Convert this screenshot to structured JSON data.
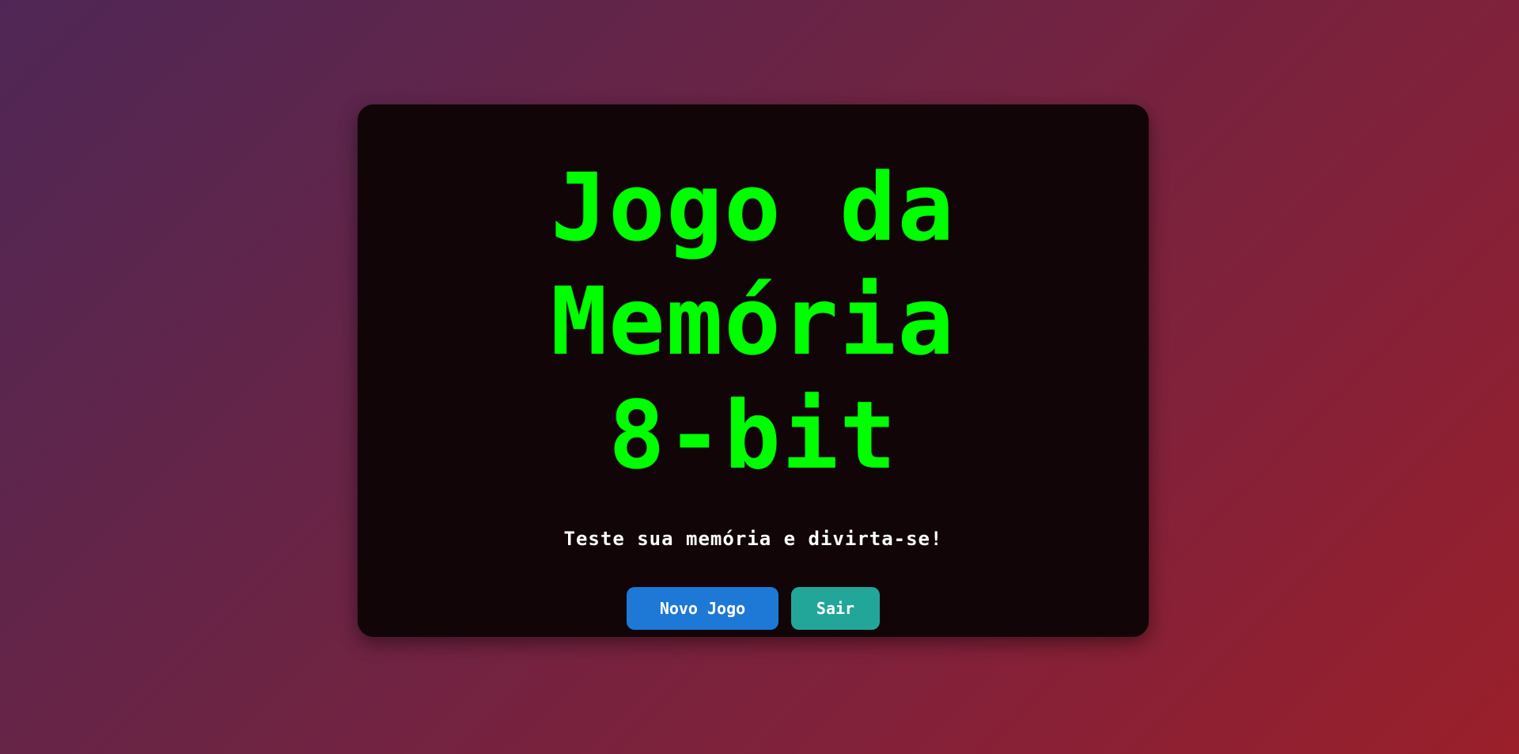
{
  "menu": {
    "title_lines": [
      "Jogo da",
      "Memória",
      "8-bit"
    ],
    "subtitle": "Teste sua memória e divirta-se!",
    "buttons": {
      "new_game_label": "Novo Jogo",
      "exit_label": "Sair"
    }
  },
  "colors": {
    "title": "#00ff00",
    "panel_background": "#110508",
    "new_game_button": "#1e78d6",
    "exit_button": "#23a69a",
    "background_gradient": [
      "#4f2756",
      "#9a1f2a"
    ]
  }
}
